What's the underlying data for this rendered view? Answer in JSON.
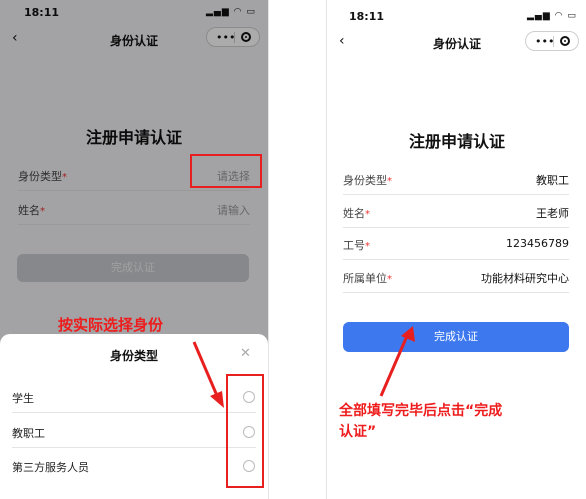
{
  "left": {
    "status_time": "18:11",
    "nav_title": "身份认证",
    "form_title": "注册申请认证",
    "fields": [
      {
        "label": "身份类型",
        "value": "请选择"
      },
      {
        "label": "姓名",
        "value": "请输入"
      }
    ],
    "submit_label": "完成认证",
    "annotation": "按实际选择身份",
    "sheet": {
      "title": "身份类型",
      "options": [
        "学生",
        "教职工",
        "第三方服务人员"
      ]
    }
  },
  "right": {
    "status_time": "18:11",
    "nav_title": "身份认证",
    "form_title": "注册申请认证",
    "fields": [
      {
        "label": "身份类型",
        "value": "教职工"
      },
      {
        "label": "姓名",
        "value": "王老师"
      },
      {
        "label": "工号",
        "value": "123456789"
      },
      {
        "label": "所属单位",
        "value": "功能材料研究中心"
      }
    ],
    "submit_label": "完成认证",
    "annotation_line1": "全部填写完毕后点击“完成",
    "annotation_line2": "认证”"
  },
  "icons": [
    "back-chevron-icon",
    "more-dots-icon",
    "target-icon",
    "close-icon",
    "radio-icon",
    "arrow-icon"
  ],
  "colors": {
    "primary": "#3d78ee",
    "annotation_red": "#e81f1f",
    "required": "#e33"
  }
}
